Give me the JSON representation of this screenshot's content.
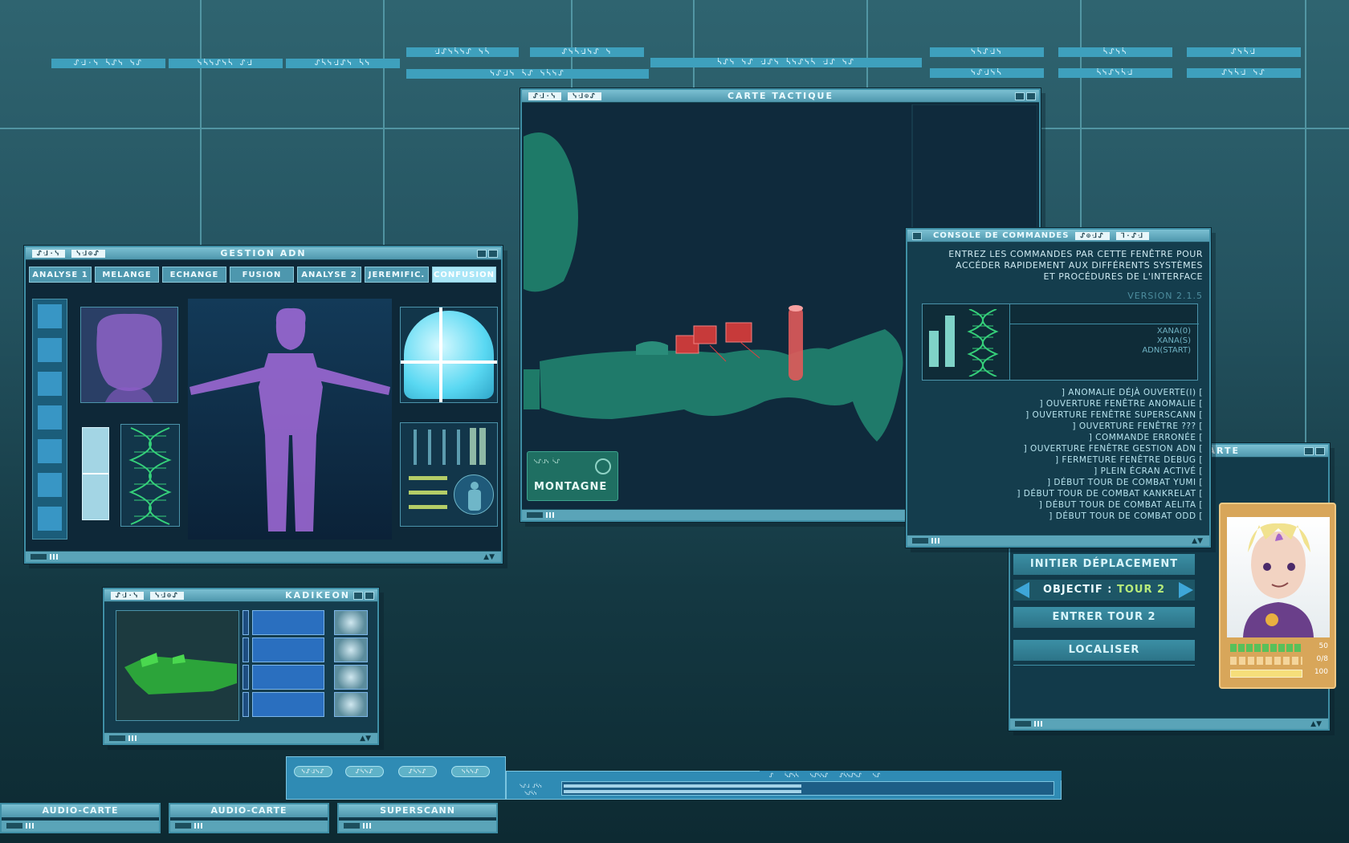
{
  "top_labels": [
    "ᔑᒲ·ᓭ ᓵᔑᓭ ᓭᔑ",
    "ᓭᓵᓭᔑᓭᓵ ᔑᒲ",
    "ᔑᓵᓭᒲᔑᓭ ᓵᓭ",
    "ᒲᔑᓭᓵᓭᔑ ᓭᓵ",
    "ᔑᓭᓵᒲᓭᔑ ᓭ",
    "ᓭᔑᒲᓭ ᓵᔑ ᓭᓵᓭᔑ",
    "ᓵᔑᓭ ᓭᔑ ᒲᔑᓭ ᓵᓭᔑᓭᓵ ᒲᔑ ᓭᔑ",
    "ᓭᓵᔑᒲᓭ",
    "ᓵᔑᓭᓵ",
    "ᔑᓭᓵᒲ",
    "ᓭᔑᒲᓭᓵ",
    "ᓵᓭᔑᓭᓵᒲ",
    "ᔑᓭᓵᒲ ᓭᔑ"
  ],
  "windows": {
    "adn": {
      "glyph1": "ᔑᒲ·ᓭ",
      "glyph2": "ᓭᒲ⊙ᔑ",
      "title": "GESTION ADN",
      "tabs": [
        "ANALYSE 1",
        "MELANGE",
        "ECHANGE",
        "FUSION",
        "ANALYSE 2",
        "JEREMIFIC.",
        "CONFUSION"
      ]
    },
    "carte": {
      "glyph1": "ᔑᒲ·ᓭ",
      "glyph2": "ᓭᒲ⊙ᔑ",
      "title": "CARTE TACTIQUE",
      "sector_small": "ᓭᔑᒲᓭ ᓵᔑ",
      "sector_name": "MONTAGNE"
    },
    "console": {
      "title": "CONSOLE DE COMMANDES",
      "glyph1": "ᔑ⊙ᒲᔑ",
      "glyph2": "ᒣ·ᔑᒲ",
      "intro_lines": [
        "ENTREZ LES COMMANDES PAR CETTE FENÊTRE POUR",
        "ACCÉDER RAPIDEMENT AUX DIFFÉRENTS SYSTÈMES",
        "ET PROCÉDURES DE L'INTERFACE"
      ],
      "version": "VERSION 2.1.5",
      "dna_lines": [
        "XANA(0)",
        "XANA(S)",
        "ADN(START)"
      ],
      "log": [
        "] ANOMALIE DÉJÀ OUVERTE(I) [",
        "] OUVERTURE FENÊTRE ANOMALIE [",
        "] OUVERTURE FENÊTRE SUPERSCANN [",
        "] OUVERTURE FENÊTRE ??? [",
        "] COMMANDE ERRONÉE [",
        "] OUVERTURE FENÊTRE GESTION ADN [",
        "] FERMETURE FENÊTRE DEBUG [",
        "] PLEIN ÉCRAN ACTIVÉ [",
        "] DÉBUT TOUR DE COMBAT YUMI [",
        "] DÉBUT TOUR DE COMBAT KANKRELAT [",
        "] DÉBUT TOUR DE COMBAT AELITA [",
        "] DÉBUT TOUR DE COMBAT ODD ["
      ]
    },
    "kadikeon": {
      "glyph1": "ᔑᒲ·ᓭ",
      "glyph2": "ᓭᒲ⊙ᔑ",
      "title": "KADIKEON"
    },
    "tcarte": {
      "title": "T-CARTE",
      "btn_move": "INITIER DÉPLACEMENT",
      "objective_label": "OBJECTIF : ",
      "objective_value": "TOUR 2",
      "btn_enter": "ENTRER TOUR 2",
      "btn_locate": "LOCALISER",
      "hp_value": "50",
      "ammo_value": "0/8",
      "energy_value": "100"
    }
  },
  "bottom_tabs": [
    "AUDIO-CARTE",
    "AUDIO-CARTE",
    "SUPERSCANN"
  ],
  "toolbar_pills": [
    "ᓭᔑᒲᓭᔑ",
    "ᔑᓵᓭᔑ",
    "ᔑᓵᓭᔑ",
    "ᓭᓵᓭᔑ"
  ],
  "progress_side": [
    "ᓭᔑᒲ ᔑᓵᓭ",
    "ᓭᔑᓵᓭ"
  ],
  "progress_header": [
    "ᔑ",
    "ᓵᔑᓭᓵ",
    "ᓭᔑᓵᓭᔑ",
    "ᔑᓵᓭᔑᓭᔑ",
    "ᓭᔑ"
  ],
  "colors": {
    "accent": "#4e97ad",
    "highlight": "#a9e6f7",
    "terrain": "#1f7a6c",
    "dna": "#35d07a",
    "hologram": "#a36bdb"
  }
}
